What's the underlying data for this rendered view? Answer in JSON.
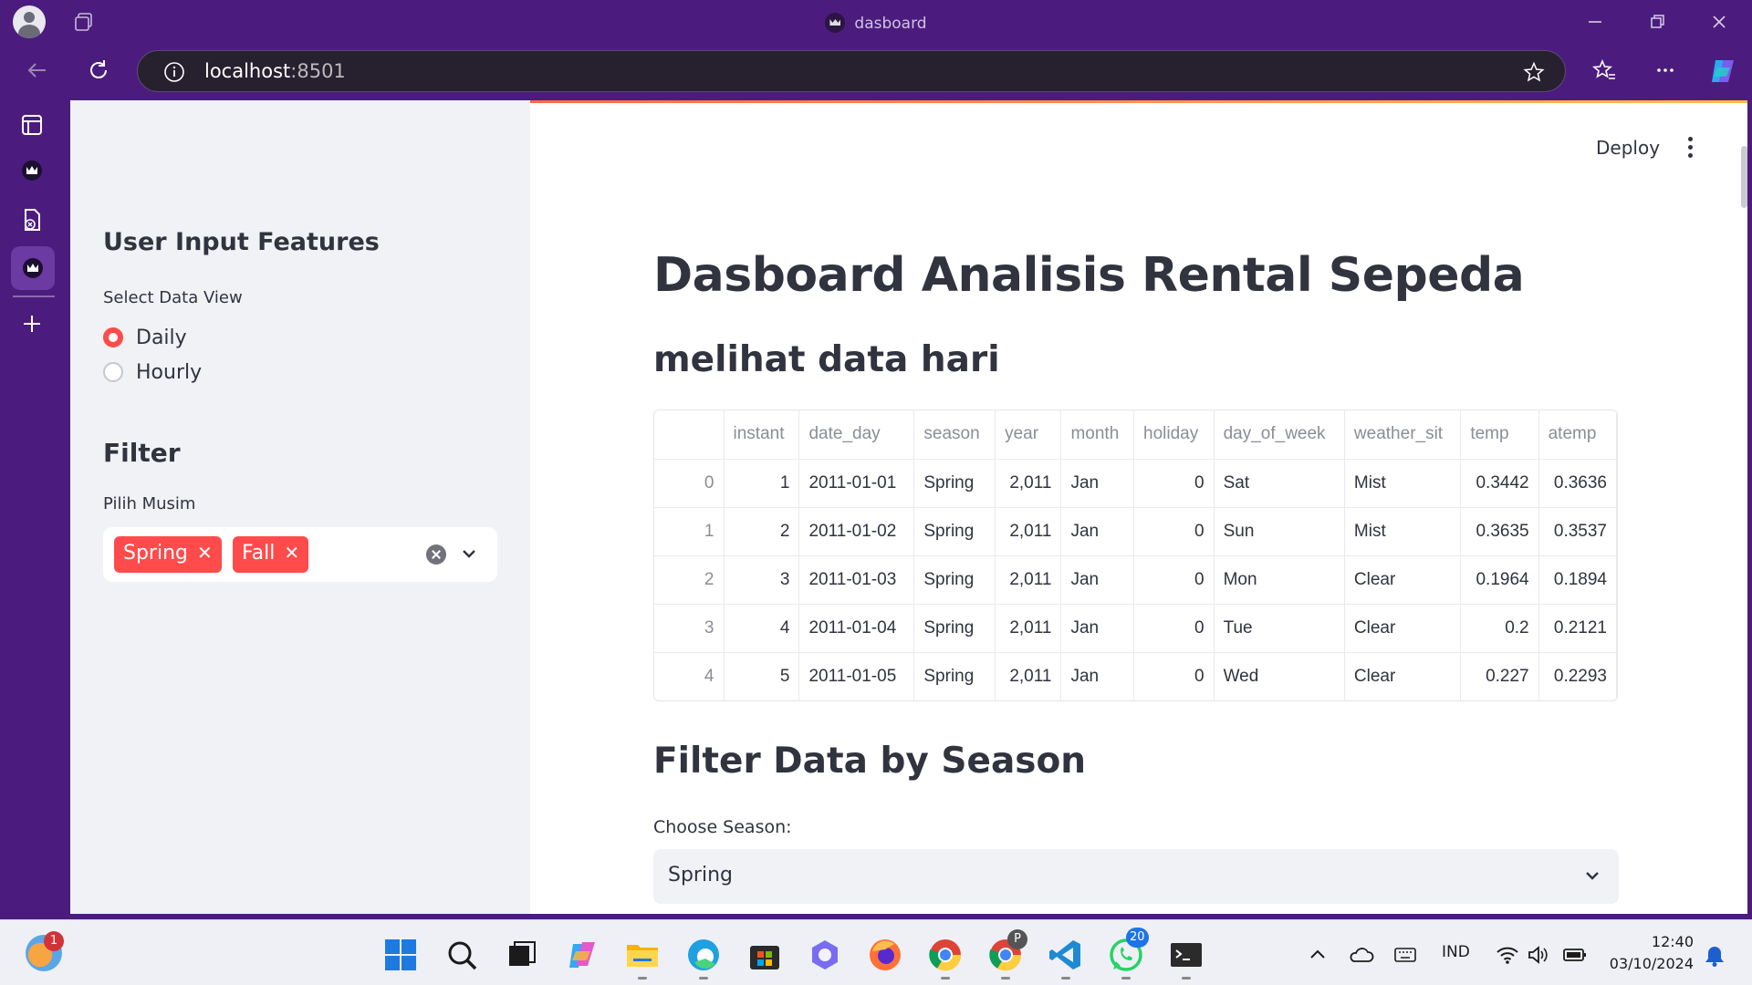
{
  "window": {
    "title": "dasboard"
  },
  "browser": {
    "url_host": "localhost",
    "url_port": ":8501"
  },
  "header": {
    "deploy_label": "Deploy"
  },
  "sidebar": {
    "title": "User Input Features",
    "data_view_label": "Select Data View",
    "data_view_options": [
      {
        "label": "Daily",
        "selected": true
      },
      {
        "label": "Hourly",
        "selected": false
      }
    ],
    "filter_title": "Filter",
    "season_label": "Pilih Musim",
    "season_chips": [
      "Spring",
      "Fall"
    ]
  },
  "main": {
    "title": "Dasboard Analisis Rental Sepeda",
    "subtitle": "melihat data hari",
    "table": {
      "columns": [
        "",
        "instant",
        "date_day",
        "season",
        "year",
        "month",
        "holiday",
        "day_of_week",
        "weather_sit",
        "temp",
        "atemp"
      ],
      "rows": [
        [
          "0",
          "1",
          "2011-01-01",
          "Spring",
          "2,011",
          "Jan",
          "0",
          "Sat",
          "Mist",
          "0.3442",
          "0.3636"
        ],
        [
          "1",
          "2",
          "2011-01-02",
          "Spring",
          "2,011",
          "Jan",
          "0",
          "Sun",
          "Mist",
          "0.3635",
          "0.3537"
        ],
        [
          "2",
          "3",
          "2011-01-03",
          "Spring",
          "2,011",
          "Jan",
          "0",
          "Mon",
          "Clear",
          "0.1964",
          "0.1894"
        ],
        [
          "3",
          "4",
          "2011-01-04",
          "Spring",
          "2,011",
          "Jan",
          "0",
          "Tue",
          "Clear",
          "0.2",
          "0.2121"
        ],
        [
          "4",
          "5",
          "2011-01-05",
          "Spring",
          "2,011",
          "Jan",
          "0",
          "Wed",
          "Clear",
          "0.227",
          "0.2293"
        ]
      ]
    },
    "filter_section_title": "Filter Data by Season",
    "choose_season_label": "Choose Season:",
    "choose_season_value": "Spring"
  },
  "taskbar": {
    "weather_badge": "1",
    "whatsapp_badge": "20",
    "chrome_profile_badge": "P",
    "language": "IND",
    "time": "12:40",
    "date": "03/10/2024"
  },
  "colors": {
    "accent": "#ff4b4b",
    "browser_frame": "#4b1c7e",
    "sidebar_bg": "#f0f2f6"
  }
}
